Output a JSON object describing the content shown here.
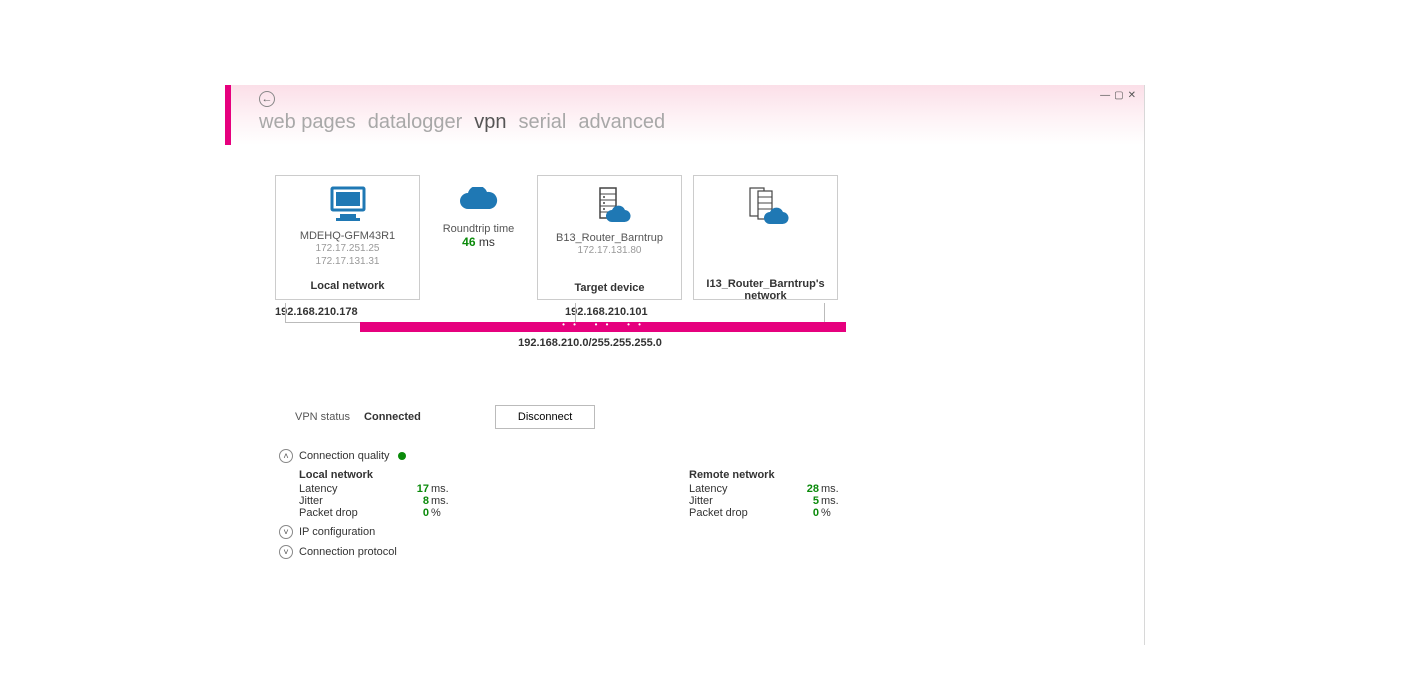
{
  "window": {
    "tabs": {
      "web_pages": "web pages",
      "datalogger": "datalogger",
      "vpn": "vpn",
      "serial": "serial",
      "advanced": "advanced"
    }
  },
  "diagram": {
    "local": {
      "name": "MDEHQ-GFM43R1",
      "ip1": "172.17.251.25",
      "ip2": "172.17.131.31",
      "label": "Local network",
      "tunnel_ip": "192.168.210.178"
    },
    "rtt": {
      "label": "Roundtrip time",
      "value": "46",
      "unit": " ms"
    },
    "target": {
      "name": "B13_Router_Barntrup",
      "ip": "172.17.131.80",
      "label": "Target device",
      "tunnel_ip": "192.168.210.101"
    },
    "remote": {
      "label": "I13_Router_Barntrup's network"
    },
    "subnet": "192.168.210.0/255.255.255.0"
  },
  "status": {
    "label": "VPN status",
    "value": "Connected",
    "disconnect": "Disconnect"
  },
  "sections": {
    "quality": {
      "title": "Connection quality",
      "local_title": "Local network",
      "remote_title": "Remote network",
      "rows": {
        "latency": "Latency",
        "jitter": "Jitter",
        "drop": "Packet drop"
      },
      "local": {
        "latency": "17",
        "jitter": "8",
        "drop": "0"
      },
      "remote": {
        "latency": "28",
        "jitter": "5",
        "drop": "0"
      },
      "units": {
        "ms": " ms.",
        "pct": " %"
      }
    },
    "ipconfig": {
      "title": "IP configuration"
    },
    "protocol": {
      "title": "Connection protocol"
    }
  }
}
